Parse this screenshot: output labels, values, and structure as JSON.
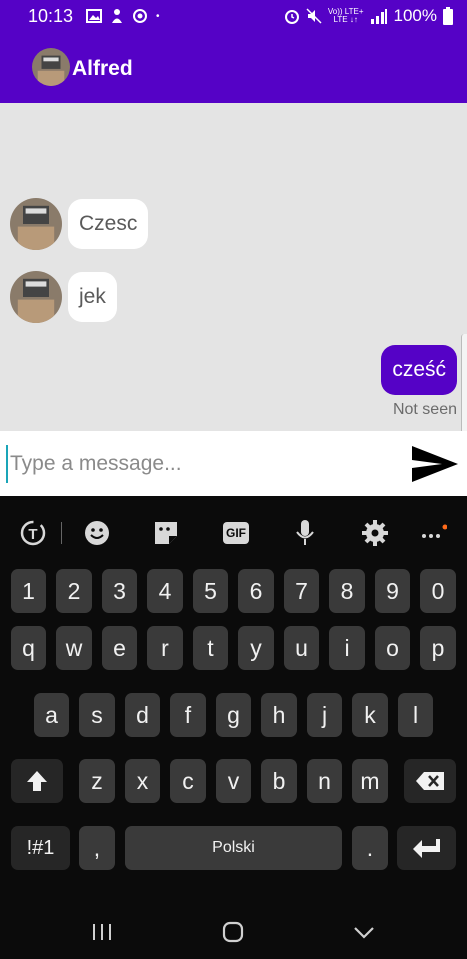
{
  "status_bar": {
    "time": "10:13",
    "network": [
      "Vo)) LTE+",
      "LTE ↓↑"
    ],
    "battery": "100%"
  },
  "app_bar": {
    "title": "Alfred"
  },
  "messages": [
    {
      "direction": "incoming",
      "text": "Czesc"
    },
    {
      "direction": "incoming",
      "text": "jek"
    },
    {
      "direction": "outgoing",
      "text": "cześć",
      "status": "Not seen"
    }
  ],
  "composer": {
    "placeholder": "Type a message..."
  },
  "keyboard": {
    "toolbar_icons": [
      "translate-icon",
      "emoji-icon",
      "sticker-icon",
      "gif-icon",
      "microphone-icon",
      "settings-icon",
      "more-icon"
    ],
    "gif_label": "GIF",
    "row_numbers": [
      "1",
      "2",
      "3",
      "4",
      "5",
      "6",
      "7",
      "8",
      "9",
      "0"
    ],
    "row_q": [
      "q",
      "w",
      "e",
      "r",
      "t",
      "y",
      "u",
      "i",
      "o",
      "p"
    ],
    "row_a": [
      "a",
      "s",
      "d",
      "f",
      "g",
      "h",
      "j",
      "k",
      "l"
    ],
    "row_z": [
      "z",
      "x",
      "c",
      "v",
      "b",
      "n",
      "m"
    ],
    "symbols_label": "!#1",
    "comma": ",",
    "space_label": "Polski",
    "period": ".",
    "accent_color": "#5502c6"
  }
}
